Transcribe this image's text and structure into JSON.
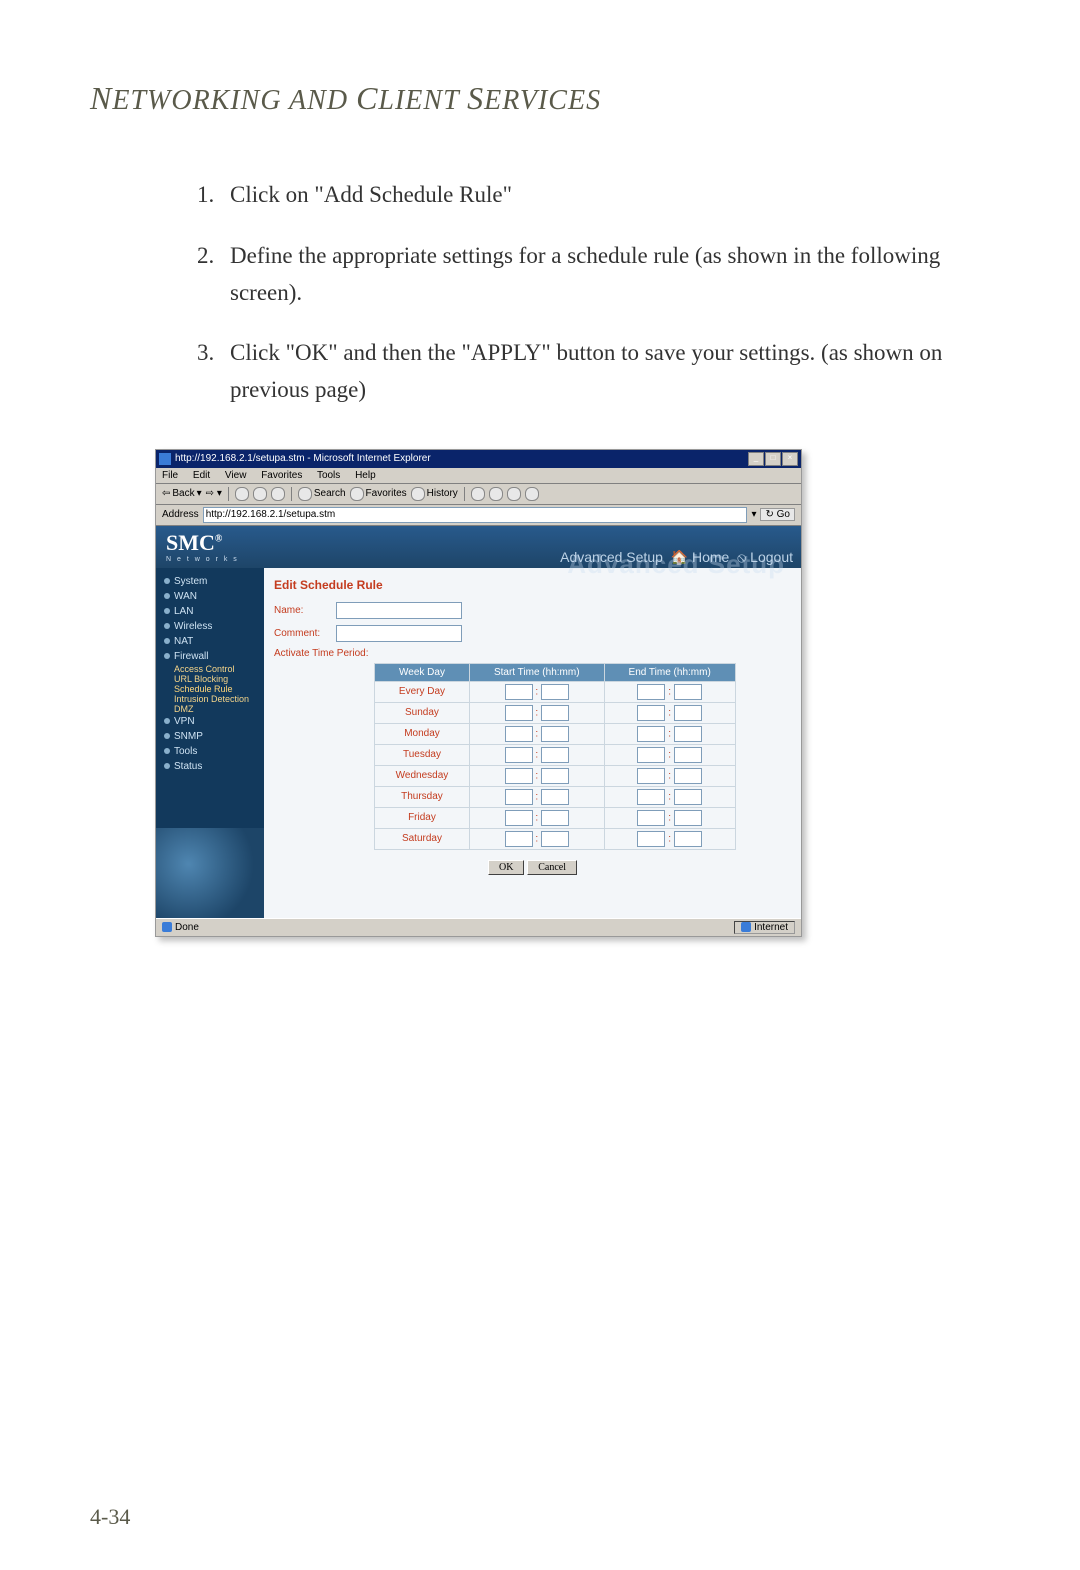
{
  "page": {
    "heading_plain": "Networking and Client Services",
    "number": "4-34"
  },
  "steps": [
    "Click on \"Add Schedule Rule\"",
    "Define the appropriate settings for a schedule rule (as shown in the following screen).",
    "Click \"OK\" and then the \"APPLY\" button to save your settings. (as shown on previous page)"
  ],
  "ie": {
    "title": "http://192.168.2.1/setupa.stm - Microsoft Internet Explorer",
    "menus": [
      "File",
      "Edit",
      "View",
      "Favorites",
      "Tools",
      "Help"
    ],
    "toolbar": {
      "back": "Back",
      "search": "Search",
      "favorites": "Favorites",
      "history": "History"
    },
    "address_label": "Address",
    "address_value": "http://192.168.2.1/setupa.stm",
    "go": "Go",
    "status_done": "Done",
    "status_zone": "Internet"
  },
  "router": {
    "brand": "SMC",
    "brand_sub": "N e t w o r k s",
    "setup_ghost": "Advanced Setup",
    "setup_label": "Advanced Setup",
    "home": "Home",
    "logout": "Logout",
    "sidebar": {
      "items": [
        "System",
        "WAN",
        "LAN",
        "Wireless",
        "NAT",
        "Firewall"
      ],
      "firewall_sub": [
        "Access Control",
        "URL Blocking",
        "Schedule Rule",
        "Intrusion Detection",
        "DMZ"
      ],
      "items2": [
        "VPN",
        "SNMP",
        "Tools",
        "Status"
      ]
    },
    "form": {
      "title": "Edit Schedule Rule",
      "name_label": "Name:",
      "name_value": "",
      "comment_label": "Comment:",
      "comment_value": "",
      "period_label": "Activate Time Period:",
      "th_day": "Week Day",
      "th_start": "Start Time (hh:mm)",
      "th_end": "End Time (hh:mm)",
      "days": [
        "Every Day",
        "Sunday",
        "Monday",
        "Tuesday",
        "Wednesday",
        "Thursday",
        "Friday",
        "Saturday"
      ],
      "ok": "OK",
      "cancel": "Cancel"
    }
  }
}
